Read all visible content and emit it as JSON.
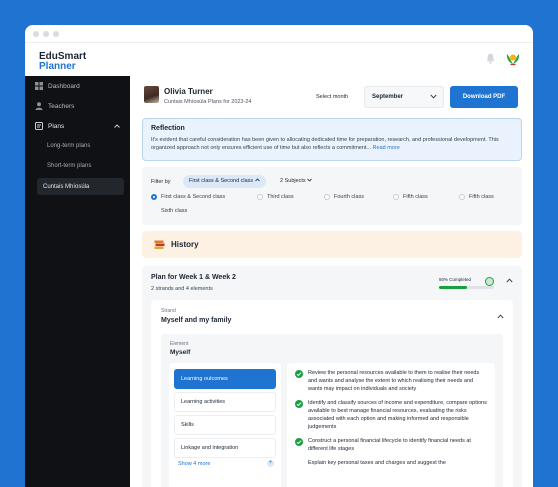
{
  "app": {
    "logo_line1": "EduSmart",
    "logo_line2": "Planner"
  },
  "sidebar": {
    "items": [
      {
        "label": "Dashboard",
        "icon": "dashboard-icon"
      },
      {
        "label": "Teachers",
        "icon": "user-icon"
      },
      {
        "label": "Plans",
        "icon": "plans-icon"
      }
    ],
    "sub_items": [
      {
        "label": "Long-term plans"
      },
      {
        "label": "Short-term plans"
      },
      {
        "label": "Cuntais Mhíosúla",
        "active": true
      }
    ]
  },
  "header": {
    "name": "Olivia Turner",
    "subtitle": "Cuntais Mhíosúla Plans for 2023-24",
    "select_month_label": "Select month",
    "month_value": "September",
    "download_label": "Download PDF"
  },
  "reflection": {
    "title": "Reflection",
    "text": "It’s evident that careful consideration has been given to allocating dedicated time for preparation, research, and professional development. This organized approach not only ensures efficient use of time but also reflects a commitment...",
    "read_more": "Read more"
  },
  "filter": {
    "label": "Filter by",
    "class_chip": "First class & Second class",
    "subjects_chip": "2 Subjects",
    "radios": [
      {
        "label": "First class & Second class",
        "selected": true
      },
      {
        "label": "Third class",
        "selected": false
      },
      {
        "label": "Fourth class",
        "selected": false
      },
      {
        "label": "Fifth class",
        "selected": false
      },
      {
        "label": "Fifth class",
        "selected": false
      },
      {
        "label": "Sixth class",
        "selected": false
      }
    ]
  },
  "history": {
    "title": "History"
  },
  "plan": {
    "title": "Plan for Week 1 & Week 2",
    "subtitle": "2 strands and 4 elements",
    "progress_label": "50% Completed",
    "progress": 0.5,
    "strand_label": "Strand",
    "strand_title": "Myself and my family",
    "element_label": "Element",
    "element_title": "Myself",
    "tabs": [
      {
        "label": "Learning outcomes",
        "active": true
      },
      {
        "label": "Learning activities",
        "active": false
      },
      {
        "label": "Skills",
        "active": false
      },
      {
        "label": "Linkage and integration",
        "active": false
      }
    ],
    "show_more": "Show 4 more",
    "outcomes": [
      "Review the personal resources available to them to realise their needs and wants and analyse the extent to which realising their needs and wants may impact on individuals and society",
      "Identify and classify sources of income and expenditure, compare options available to best manage financial resources, evaluating the risks associated with each option and making informed and responsible judgements",
      "Construct a personal financial lifecycle to identify financial needs at different life stages",
      "Explain key personal taxes and charges and suggest the"
    ]
  },
  "colors": {
    "accent": "#1f73d1",
    "sidebar_bg": "#0f1115",
    "success": "#18a03f"
  }
}
